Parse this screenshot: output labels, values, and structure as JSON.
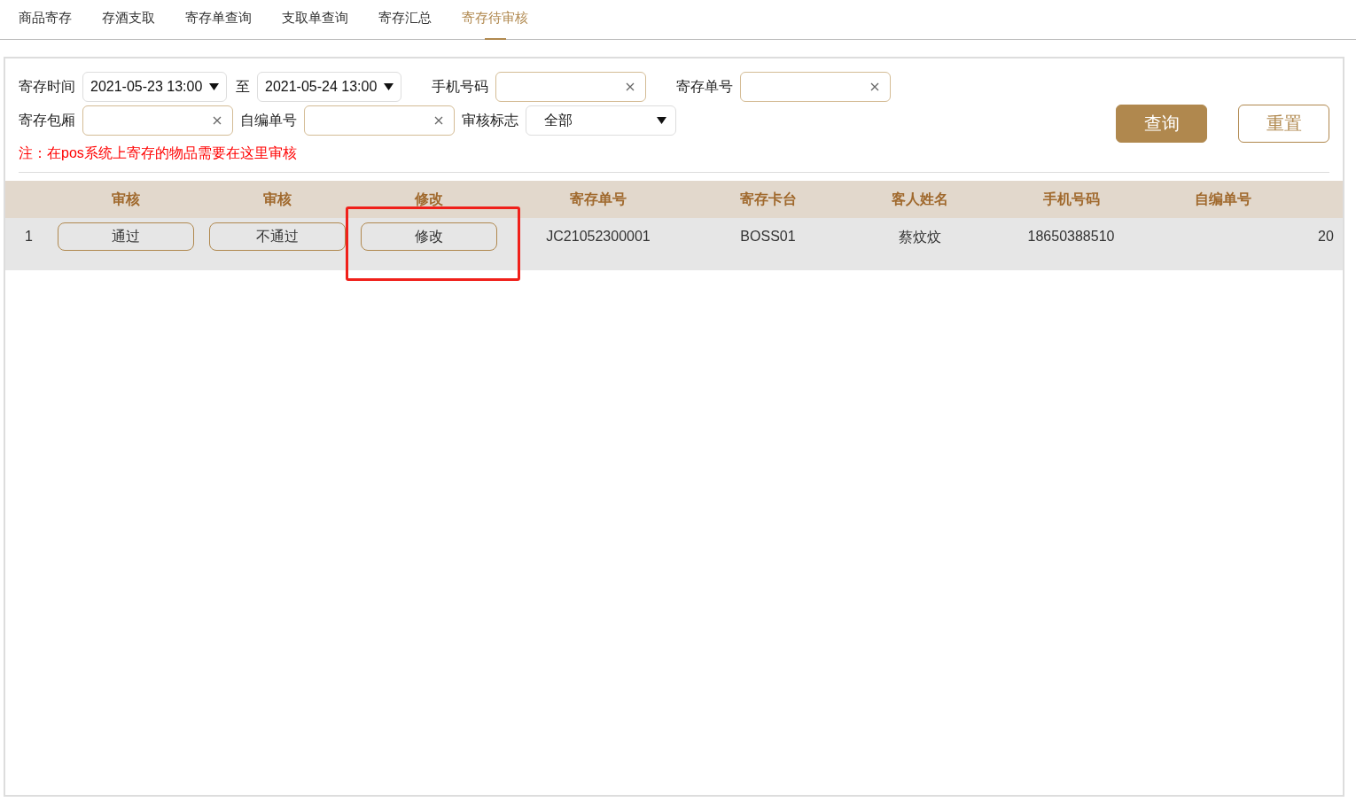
{
  "tabs": [
    {
      "label": "商品寄存",
      "selected": false
    },
    {
      "label": "存酒支取",
      "selected": false
    },
    {
      "label": "寄存单查询",
      "selected": false
    },
    {
      "label": "支取单查询",
      "selected": false
    },
    {
      "label": "寄存汇总",
      "selected": false
    },
    {
      "label": "寄存待审核",
      "selected": true
    }
  ],
  "filters": {
    "rows": [
      [
        {
          "kind": "date",
          "label": "寄存时间",
          "value": "2021-05-23 13:00"
        },
        {
          "kind": "date",
          "label": "至",
          "value": "2021-05-24 13:00"
        },
        {
          "kind": "text",
          "label": "手机号码"
        },
        {
          "kind": "text",
          "label": "寄存单号"
        }
      ],
      [
        {
          "kind": "text",
          "label": "寄存包厢"
        },
        {
          "kind": "text",
          "label": "自编单号"
        },
        {
          "kind": "select",
          "label": "审核标志",
          "value": "全部"
        }
      ]
    ],
    "buttons": [
      {
        "kind": "primary",
        "label": "查询"
      },
      {
        "kind": "secondary",
        "label": "重置"
      }
    ],
    "note": "注：在pos系统上寄存的物品需要在这里审核"
  },
  "table": {
    "columns": [
      {
        "label": "审核"
      },
      {
        "label": "审核"
      },
      {
        "label": "修改"
      },
      {
        "label": "寄存单号"
      },
      {
        "label": "寄存卡台"
      },
      {
        "label": "客人姓名"
      },
      {
        "label": "手机号码"
      },
      {
        "label": "自编单号"
      }
    ],
    "rows": [
      {
        "index": "1",
        "selected": true,
        "cells": [
          {
            "kind": "button",
            "text": "通过",
            "highlighted": false
          },
          {
            "kind": "button",
            "text": "不通过",
            "highlighted": false
          },
          {
            "kind": "button",
            "text": "修改",
            "highlighted": true
          },
          {
            "kind": "text",
            "text": "JC21052300001"
          },
          {
            "kind": "text",
            "text": "BOSS01"
          },
          {
            "kind": "text",
            "text": "蔡炆炆"
          },
          {
            "kind": "text",
            "text": "18650388510"
          },
          {
            "kind": "empty"
          },
          {
            "kind": "text",
            "text": "20"
          }
        ]
      }
    ]
  }
}
